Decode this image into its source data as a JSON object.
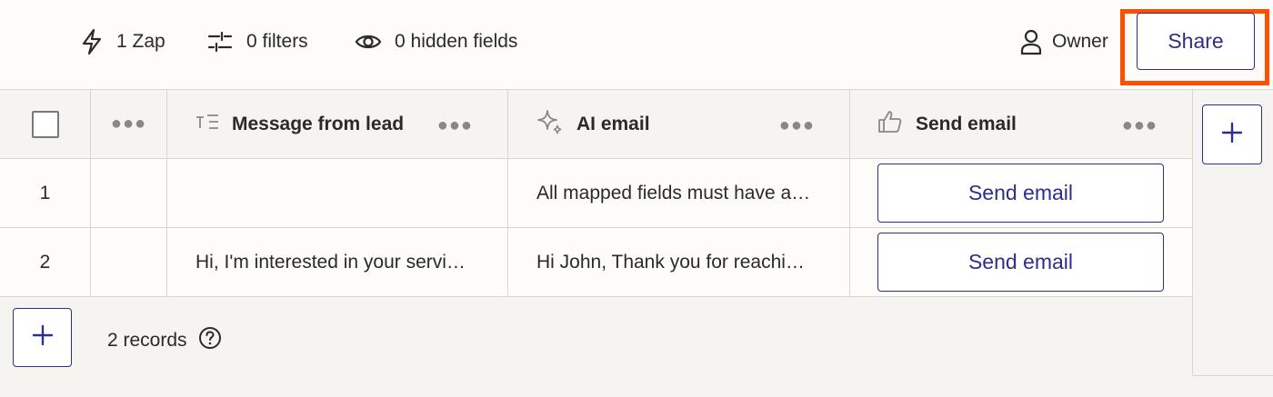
{
  "toolbar": {
    "zaps": "1 Zap",
    "filters": "0 filters",
    "hidden_fields": "0 hidden fields",
    "owner": "Owner",
    "share": "Share"
  },
  "table": {
    "columns": [
      {
        "label": "Message from lead",
        "icon": "text-icon"
      },
      {
        "label": "AI email",
        "icon": "sparkle-icon"
      },
      {
        "label": "Send email",
        "icon": "thumbs-up-icon"
      }
    ],
    "rows": [
      {
        "num": "1",
        "message": "",
        "ai_email": "All mapped fields must have a…",
        "button": "Send email"
      },
      {
        "num": "2",
        "message": "Hi, I'm interested in your servi…",
        "ai_email": "Hi John, Thank you for reachi…",
        "button": "Send email"
      }
    ]
  },
  "footer": {
    "records": "2 records"
  },
  "colors": {
    "accent": "#2d2e8c",
    "highlight": "#ff4f00"
  }
}
